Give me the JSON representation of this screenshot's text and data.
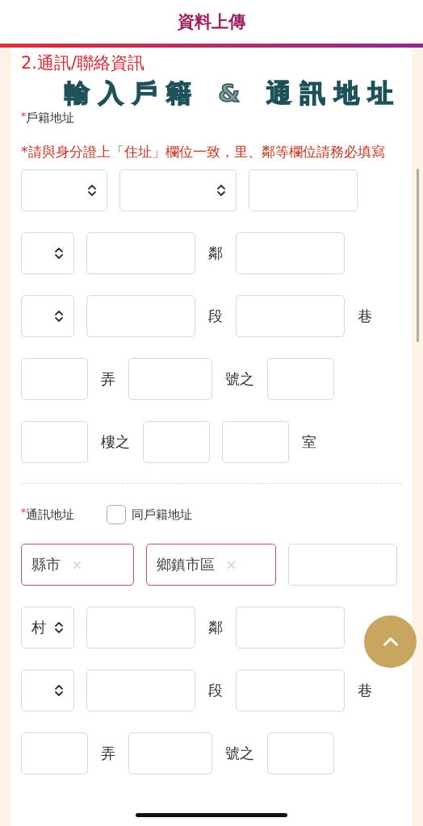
{
  "header": {
    "title": "資料上傳"
  },
  "section": {
    "title": "2.通訊/聯絡資訊",
    "banner": "輸入戶籍 & 通訊地址"
  },
  "household": {
    "mark": "*",
    "label": "戶籍地址",
    "note": "*請與身分證上「住址」欄位一致，里、鄰等欄位請務必填寫",
    "rows": [
      [
        {
          "kind": "dropdown"
        },
        {
          "kind": "widedropdown"
        },
        {
          "kind": "field"
        }
      ],
      [
        {
          "kind": "shortdropdown"
        },
        {
          "kind": "field"
        },
        {
          "kind": "label",
          "text": "鄰"
        },
        {
          "kind": "field"
        }
      ],
      [
        {
          "kind": "shortdropdown"
        },
        {
          "kind": "field"
        },
        {
          "kind": "label",
          "text": "段"
        },
        {
          "kind": "field"
        },
        {
          "kind": "label",
          "text": "巷"
        }
      ],
      [
        {
          "kind": "shortfield"
        },
        {
          "kind": "label",
          "text": "弄"
        },
        {
          "kind": "midfield"
        },
        {
          "kind": "label",
          "text": "號之"
        },
        {
          "kind": "shortfield"
        }
      ],
      [
        {
          "kind": "shortfield"
        },
        {
          "kind": "label",
          "text": "樓之"
        },
        {
          "kind": "shortfield"
        },
        {
          "kind": "shortfield"
        },
        {
          "kind": "label",
          "text": "室"
        }
      ]
    ]
  },
  "mailing": {
    "mark": "*",
    "label": "通訊地址",
    "same_as": {
      "label": "同戶籍地址",
      "checked": false
    },
    "rows": [
      [
        {
          "kind": "chip",
          "value": "縣市",
          "invalid": true
        },
        {
          "kind": "widechip",
          "value": "鄉鎮市區",
          "invalid": true
        },
        {
          "kind": "field"
        }
      ],
      [
        {
          "kind": "shortdropdown",
          "value": "村"
        },
        {
          "kind": "field"
        },
        {
          "kind": "label",
          "text": "鄰"
        },
        {
          "kind": "field"
        }
      ],
      [
        {
          "kind": "shortdropdown"
        },
        {
          "kind": "field"
        },
        {
          "kind": "label",
          "text": "段"
        },
        {
          "kind": "field"
        },
        {
          "kind": "label",
          "text": "巷"
        }
      ],
      [
        {
          "kind": "shortfield"
        },
        {
          "kind": "label",
          "text": "弄"
        },
        {
          "kind": "midfield"
        },
        {
          "kind": "label",
          "text": "號之"
        },
        {
          "kind": "shortfield"
        }
      ]
    ]
  }
}
